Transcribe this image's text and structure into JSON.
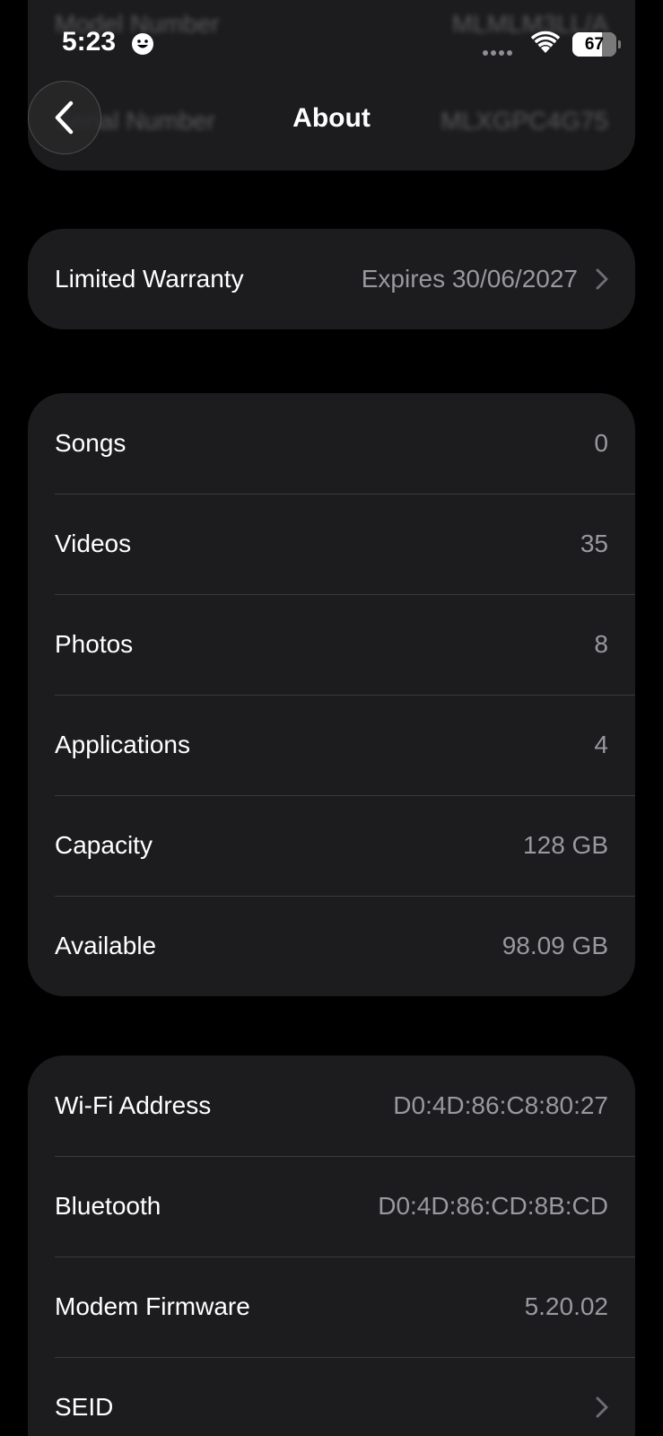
{
  "status_bar": {
    "time": "5:23",
    "battery_level": "67",
    "battery_fraction": 0.67
  },
  "behind": {
    "rows": [
      {
        "label": "Model Number",
        "value": "MLMLM3LL/A"
      },
      {
        "label": "Serial Number",
        "value": "MLXGPC4G75"
      }
    ]
  },
  "header": {
    "title": "About"
  },
  "warranty": {
    "label": "Limited Warranty",
    "value": "Expires 30/06/2027"
  },
  "media": {
    "rows": [
      {
        "label": "Songs",
        "value": "0"
      },
      {
        "label": "Videos",
        "value": "35"
      },
      {
        "label": "Photos",
        "value": "8"
      },
      {
        "label": "Applications",
        "value": "4"
      },
      {
        "label": "Capacity",
        "value": "128 GB"
      },
      {
        "label": "Available",
        "value": "98.09 GB"
      }
    ]
  },
  "network": {
    "rows": [
      {
        "label": "Wi-Fi Address",
        "value": "D0:4D:86:C8:80:27"
      },
      {
        "label": "Bluetooth",
        "value": "D0:4D:86:CD:8B:CD"
      },
      {
        "label": "Modem Firmware",
        "value": "5.20.02"
      },
      {
        "label": "SEID",
        "value": ""
      }
    ]
  },
  "colors": {
    "background": "#000000",
    "card": "#1c1c1e",
    "secondary_text": "#98989e",
    "separator": "#3a3a3c"
  }
}
